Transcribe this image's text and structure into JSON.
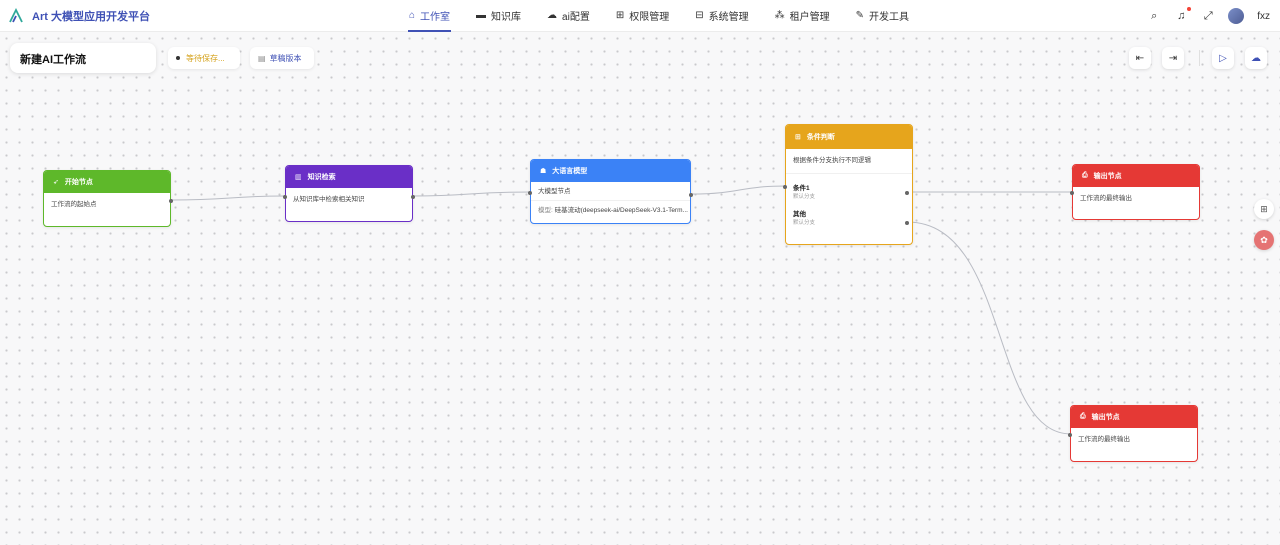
{
  "app": {
    "title": "Art 大模型应用开发平台"
  },
  "nav": {
    "items": [
      {
        "label": "工作室",
        "icon": "bank-icon",
        "glyph": "⌂",
        "active": true
      },
      {
        "label": "知识库",
        "icon": "folder-icon",
        "glyph": "▬",
        "active": false
      },
      {
        "label": "ai配置",
        "icon": "cloud-icon",
        "glyph": "☁",
        "active": false
      },
      {
        "label": "权限管理",
        "icon": "grid-icon",
        "glyph": "⊞",
        "active": false
      },
      {
        "label": "系统管理",
        "icon": "window-icon",
        "glyph": "⊟",
        "active": false
      },
      {
        "label": "租户管理",
        "icon": "users-icon",
        "glyph": "⁂",
        "active": false
      },
      {
        "label": "开发工具",
        "icon": "wrench-icon",
        "glyph": "✎",
        "active": false
      }
    ]
  },
  "user": {
    "name": "fxz"
  },
  "workflow": {
    "title": "新建AI工作流",
    "save_status": "等待保存...",
    "version": "草稿版本"
  },
  "nodes": {
    "start": {
      "title": "开始节点",
      "desc": "工作流的起始点",
      "color": "#5eb82a"
    },
    "knowledge": {
      "title": "知识检索",
      "desc": "从知识库中检索相关知识",
      "color": "#6a2fc7"
    },
    "llm": {
      "title": "大语言模型",
      "desc": "大模型节点",
      "model_label": "模型:",
      "model_value": "硅基流动(deepseek-ai/DeepSeek-V3.1-Term...",
      "color": "#3b82f6"
    },
    "condition": {
      "title": "条件判断",
      "desc": "根据条件分支执行不同逻辑",
      "branch1_label": "条件1",
      "branch1_sub": "默认分支",
      "else_label": "其他",
      "else_sub": "默认分支",
      "color": "#e6a51c"
    },
    "output1": {
      "title": "输出节点",
      "desc": "工作流的最终输出",
      "color": "#e53935"
    },
    "output2": {
      "title": "输出节点",
      "desc": "工作流的最终输出",
      "color": "#e53935"
    }
  },
  "colors": {
    "accent": "#3f51b5",
    "edge": "#b9bcc4"
  }
}
